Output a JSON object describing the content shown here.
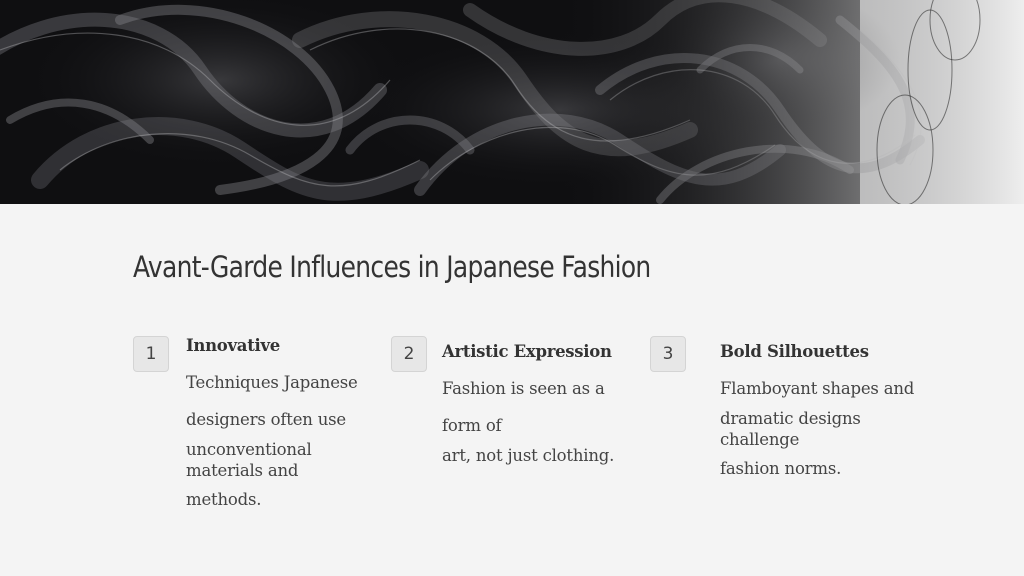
{
  "title": "Avant-Garde Influences in Japanese Fashion",
  "hero_image": "abstract-black-mesh-swirls",
  "items": [
    {
      "number": "1",
      "heading": "Innovative",
      "lines": [
        "Techniques Japanese",
        "designers often use",
        "unconventional",
        "materials and",
        "methods."
      ]
    },
    {
      "number": "2",
      "heading": "Artistic Expression",
      "lines": [
        "Fashion is seen as a",
        "form of",
        "art, not just clothing."
      ]
    },
    {
      "number": "3",
      "heading": "Bold Silhouettes",
      "lines": [
        "Flamboyant shapes and",
        "dramatic designs",
        "challenge",
        "fashion norms."
      ]
    }
  ]
}
